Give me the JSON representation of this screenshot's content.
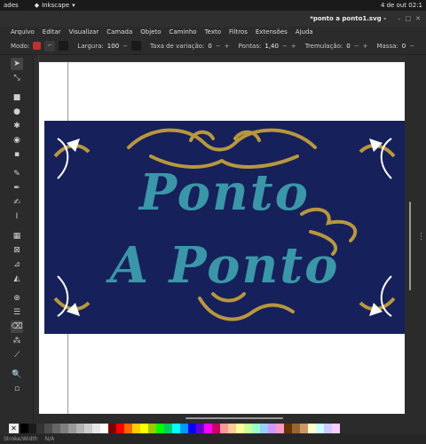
{
  "topbar": {
    "activities": "ades",
    "app_name": "Inkscape",
    "clock": "4 de out  02:1"
  },
  "window": {
    "title": "*ponto a ponto1.svg -"
  },
  "menu": {
    "items": [
      "Arquivo",
      "Editar",
      "Visualizar",
      "Camada",
      "Objeto",
      "Caminho",
      "Texto",
      "Filtros",
      "Extensões",
      "Ajuda"
    ]
  },
  "tool_controls": {
    "mode_label": "Modo:",
    "width_label": "Largura:",
    "width_value": "100",
    "variation_label": "Taxa de variação:",
    "variation_value": "0",
    "points_label": "Pontas:",
    "points_value": "1,40",
    "tremor_label": "Tremulação:",
    "tremor_value": "0",
    "mass_label": "Massa:",
    "mass_value": "0"
  },
  "artwork": {
    "line1": "Ponto",
    "line2": "A Ponto",
    "bg_color": "#16205a",
    "text_color": "#3a96a8",
    "ornament_color": "#b8973e"
  },
  "statusbar": {
    "label": "Stroke/Width",
    "value": "N/A"
  },
  "palette": [
    "#000000",
    "#1a1a1a",
    "#333333",
    "#4d4d4d",
    "#666666",
    "#808080",
    "#999999",
    "#b3b3b3",
    "#cccccc",
    "#e6e6e6",
    "#ffffff",
    "#800000",
    "#ff0000",
    "#ff6600",
    "#ffcc00",
    "#ffff00",
    "#99cc00",
    "#00ff00",
    "#00cc66",
    "#00ffff",
    "#0099ff",
    "#0000ff",
    "#6600cc",
    "#ff00ff",
    "#cc0066",
    "#ff9999",
    "#ffcc99",
    "#ffff99",
    "#ccff99",
    "#99ffcc",
    "#99ccff",
    "#cc99ff",
    "#ff99cc",
    "#663300",
    "#996633",
    "#cc9966",
    "#ffffcc",
    "#ccffff",
    "#ccccff",
    "#ffccff"
  ]
}
